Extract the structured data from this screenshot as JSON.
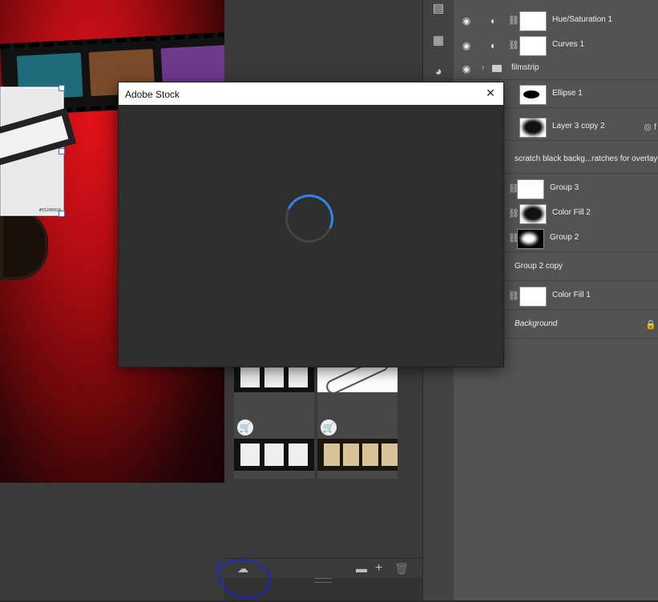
{
  "dialog": {
    "title": "Adobe Stock",
    "close_glyph": "×"
  },
  "canvas": {
    "asset_id": "#55200910"
  },
  "layers": [
    {
      "name": "Hue/Saturation 1",
      "visible": true,
      "type": "adjustment"
    },
    {
      "name": "Curves 1",
      "visible": true,
      "type": "adjustment"
    },
    {
      "name": "filmstrip",
      "visible": true,
      "type": "group"
    },
    {
      "name": "Ellipse 1",
      "visible": true,
      "type": "shape"
    },
    {
      "name": "Layer 3 copy 2",
      "visible": true,
      "type": "pixel"
    },
    {
      "name": "scratch black backg...ratches for overlay",
      "visible": false,
      "type": "pixel"
    },
    {
      "name": "Group 3",
      "visible": false,
      "type": "group"
    },
    {
      "name": "Color Fill 2",
      "visible": false,
      "type": "fill"
    },
    {
      "name": "Group 2",
      "visible": false,
      "type": "group"
    },
    {
      "name": "Group 2 copy",
      "visible": false,
      "type": "group"
    },
    {
      "name": "Color Fill 1",
      "visible": false,
      "type": "fill"
    },
    {
      "name": "Background",
      "visible": false,
      "type": "background"
    }
  ],
  "colors": {
    "accent": "#2f86e6",
    "annotation": "#1a27c8",
    "panel": "#535353"
  }
}
